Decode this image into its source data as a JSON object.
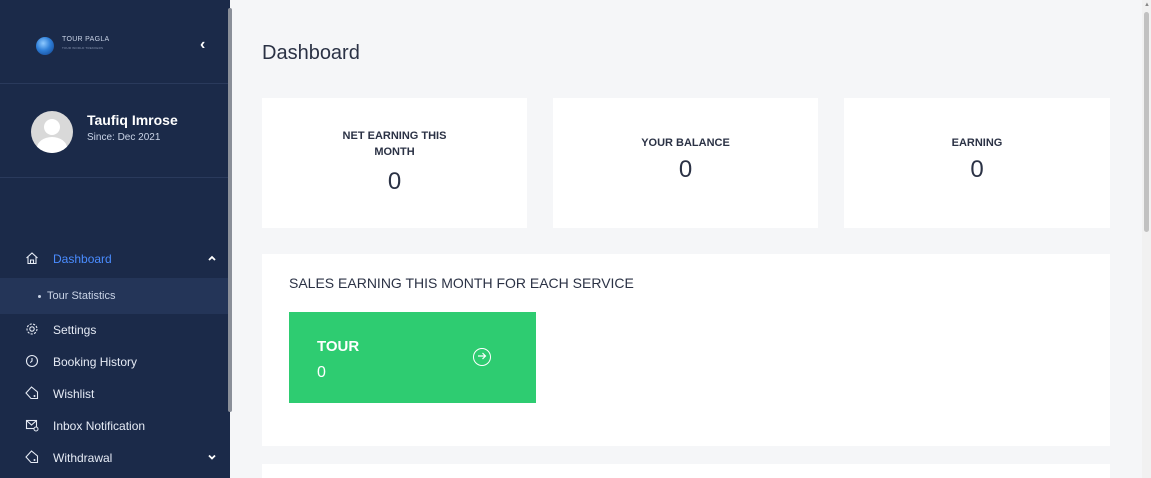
{
  "sidebar": {
    "brand": {
      "logo_text": "TOUR PAGLA",
      "logo_sub": "TOUR WORLD TREKKERS",
      "collapse_glyph": "‹"
    },
    "profile": {
      "name": "Taufiq Imrose",
      "since": "Since: Dec 2021"
    },
    "menu": [
      {
        "label": "Dashboard",
        "icon": "home-icon",
        "active": true,
        "expanded": true
      },
      {
        "label": "Tour Statistics",
        "sub": true
      },
      {
        "label": "Settings",
        "icon": "gear-icon"
      },
      {
        "label": "Booking History",
        "icon": "clock-icon"
      },
      {
        "label": "Wishlist",
        "icon": "tag-icon"
      },
      {
        "label": "Inbox Notification",
        "icon": "mail-icon"
      },
      {
        "label": "Withdrawal",
        "icon": "tag-icon",
        "collapsible": true
      }
    ]
  },
  "main": {
    "title": "Dashboard",
    "cards": [
      {
        "label": "NET EARNING THIS MONTH",
        "value": "0"
      },
      {
        "label": "YOUR BALANCE",
        "value": "0"
      },
      {
        "label": "EARNING",
        "value": "0"
      }
    ],
    "sales_panel": {
      "heading": "SALES EARNING THIS MONTH FOR EACH SERVICE",
      "tiles": [
        {
          "name": "TOUR",
          "value": "0",
          "icon": "arrow-right-circle-icon"
        }
      ]
    }
  },
  "colors": {
    "sidebar": "#1b2a49",
    "active": "#4a8cff",
    "tile": "#2ecc71",
    "background": "#f5f6f8"
  }
}
